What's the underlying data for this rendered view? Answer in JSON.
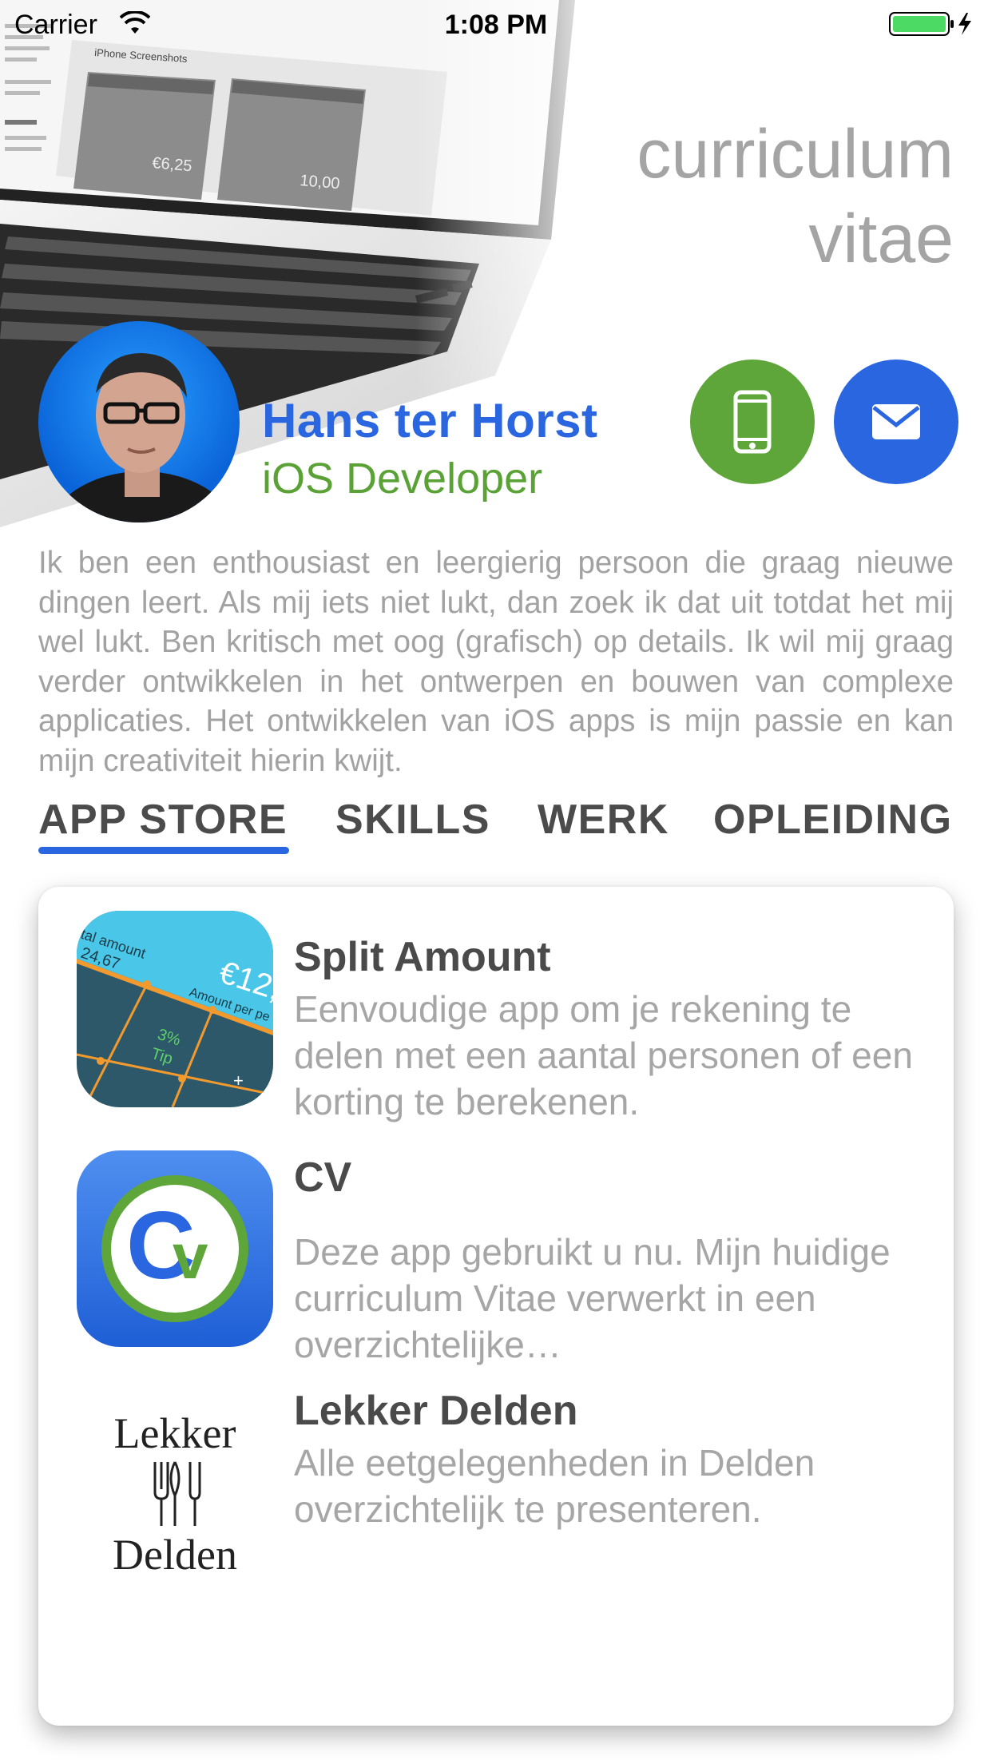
{
  "status_bar": {
    "carrier": "Carrier",
    "time": "1:08 PM"
  },
  "header": {
    "title": "curriculum vitae"
  },
  "profile": {
    "name": "Hans ter Horst",
    "role": "iOS Developer",
    "intro": "Ik ben een enthousiast en leergierig persoon die graag nieuwe dingen leert. Als mij iets niet lukt, dan zoek ik dat uit totdat het mij wel lukt. Ben kritisch met oog (grafisch) op details. Ik wil mij graag verder ontwikkelen in het ontwerpen en bouwen van complexe applicaties. Het ontwikkelen van iOS apps is mijn passie en kan mijn creativiteit hierin kwijt."
  },
  "actions": {
    "phone_icon": "phone-icon",
    "mail_icon": "mail-icon"
  },
  "tabs": [
    {
      "label": "APP STORE",
      "selected": true
    },
    {
      "label": "SKILLS",
      "selected": false
    },
    {
      "label": "WERK",
      "selected": false
    },
    {
      "label": "OPLEIDING",
      "selected": false
    }
  ],
  "apps": [
    {
      "name": "Split Amount",
      "description": "Eenvoudige app om je rekening te delen met een aantal personen of een korting te berekenen.",
      "icon_texts": [
        "tal amount",
        "24,67",
        "€12,",
        "Amount per pe",
        "3%",
        "Tip",
        "+"
      ]
    },
    {
      "name": "CV",
      "description": "Deze app gebruikt u nu. Mijn huidige curriculum Vitae verwerkt in een overzichtelijke…",
      "icon_texts": [
        "C",
        "v"
      ]
    },
    {
      "name": "Lekker Delden",
      "description": "Alle eetgelegenheden in Delden overzichtelijk te presenteren.",
      "icon_texts": [
        "Lekker",
        "Delden"
      ]
    }
  ],
  "laptop_screen": {
    "heading": "iPhone Screenshots",
    "left_value": "€6,25",
    "right_value": "10,00"
  },
  "colors": {
    "accent_blue": "#2a66e0",
    "accent_green": "#5ea53a",
    "title_gray": "#a4a4a4",
    "battery_green": "#4cd964"
  }
}
